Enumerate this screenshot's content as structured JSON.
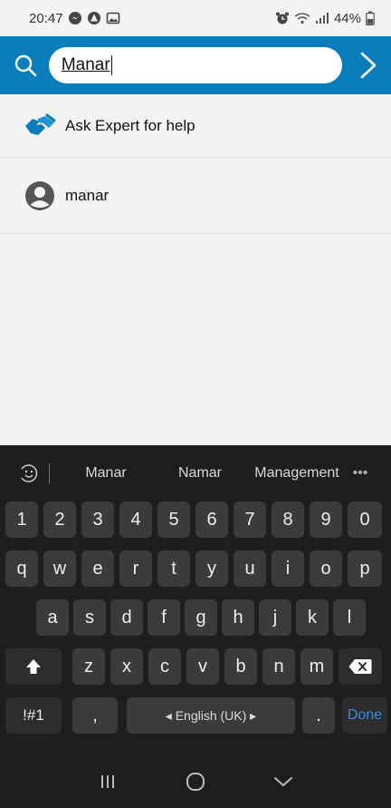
{
  "status_bar": {
    "time": "20:47",
    "battery": "44%"
  },
  "search": {
    "query": "Manar"
  },
  "results": [
    {
      "label": "Ask Expert for help",
      "icon": "handshake-icon"
    },
    {
      "label": "manar",
      "icon": "user-avatar-icon"
    }
  ],
  "keyboard": {
    "suggestions": [
      "Manar",
      "Namar",
      "Management"
    ],
    "more": "•••",
    "number_row": [
      "1",
      "2",
      "3",
      "4",
      "5",
      "6",
      "7",
      "8",
      "9",
      "0"
    ],
    "row1": [
      "q",
      "w",
      "e",
      "r",
      "t",
      "y",
      "u",
      "i",
      "o",
      "p"
    ],
    "row2": [
      "a",
      "s",
      "d",
      "f",
      "g",
      "h",
      "j",
      "k",
      "l"
    ],
    "row3": [
      "z",
      "x",
      "c",
      "v",
      "b",
      "n",
      "m"
    ],
    "symbols_label": "!#1",
    "comma": ",",
    "space_label": "◂ English (UK) ▸",
    "period": ".",
    "done_label": "Done"
  },
  "colors": {
    "header": "#0a7dbd",
    "keyboard_bg": "#1e1e1e",
    "key": "#3b3b3b",
    "done": "#3a8bd9"
  }
}
